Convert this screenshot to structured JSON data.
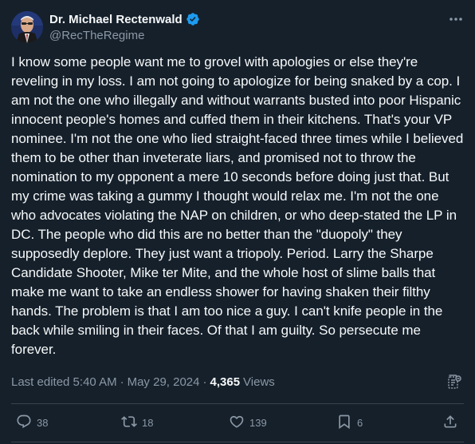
{
  "author": {
    "display_name": "Dr. Michael Rectenwald",
    "handle": "@RecTheRegime",
    "verified": true
  },
  "post": {
    "text": "I know some people want me to grovel with apologies or else they're reveling in my loss. I am not going to apologize for being snaked by a cop. I am not the one who illegally and without warrants busted into poor Hispanic innocent people's homes and cuffed them in their kitchens. That's your VP nominee. I'm not the one who lied straight-faced three times while I believed them to be other than inveterate liars, and promised not to throw the nomination to my opponent a mere 10 seconds before doing just that. But my crime was taking a gummy I thought would relax me. I'm not the one who advocates violating the NAP on children, or who deep-stated the LP in DC. The people who did this are no better than the \"duopoly\" they supposedly deplore. They just want a triopoly. Period. Larry the Sharpe Candidate Shooter, Mike ter Mite, and the whole host of slime balls that make me want to take an endless shower for having shaken their filthy hands. The problem is that I am too nice a guy. I can't knife people in the back while smiling in their faces. Of that I am guilty. So persecute me forever."
  },
  "meta": {
    "edited": "Last edited 5:40 AM",
    "date": "May 29, 2024",
    "views_count": "4,365",
    "views_label": "Views"
  },
  "actions": {
    "replies": "38",
    "reposts": "18",
    "likes": "139",
    "bookmarks": "6"
  },
  "colors": {
    "background": "#15202b",
    "text": "#f7f9f9",
    "muted": "#8b98a5",
    "verified": "#1d9bf0",
    "divider": "#38444d"
  },
  "icons": {
    "more": "more-horizontal-icon",
    "verified": "verified-badge-icon",
    "analytics": "post-analytics-icon",
    "reply": "reply-icon",
    "repost": "repost-icon",
    "like": "heart-icon",
    "bookmark": "bookmark-icon",
    "share": "share-icon"
  }
}
